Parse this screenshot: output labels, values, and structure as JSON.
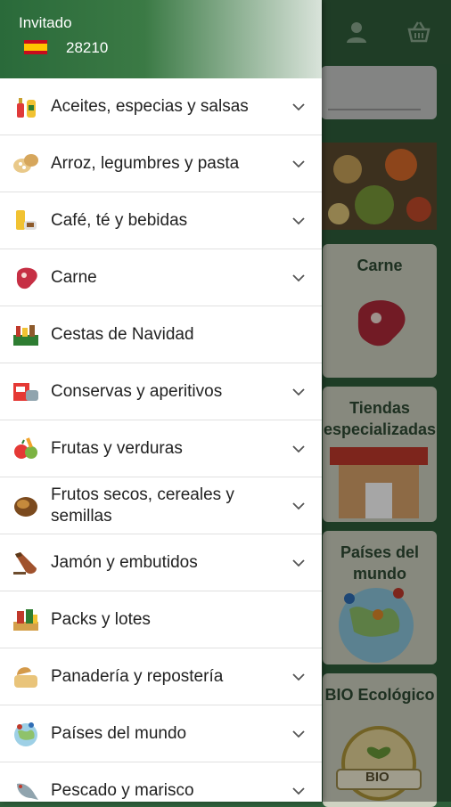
{
  "drawer": {
    "guest_label": "Invitado",
    "country_flag": "spain-flag-icon",
    "postcode": "28210"
  },
  "menu": [
    {
      "label": "Aceites, especias y salsas",
      "icon": "oil-bottle-icon",
      "expandable": true
    },
    {
      "label": "Arroz, legumbres y pasta",
      "icon": "grains-icon",
      "expandable": true
    },
    {
      "label": "Café, té y bebidas",
      "icon": "coffee-icon",
      "expandable": true
    },
    {
      "label": "Carne",
      "icon": "steak-icon",
      "expandable": true
    },
    {
      "label": "Cestas de Navidad",
      "icon": "christmas-basket-icon",
      "expandable": false
    },
    {
      "label": "Conservas y aperitivos",
      "icon": "canned-food-icon",
      "expandable": true
    },
    {
      "label": "Frutas y verduras",
      "icon": "fruit-icon",
      "expandable": true
    },
    {
      "label": "Frutos secos, cereales y semillas",
      "icon": "nut-icon",
      "expandable": true
    },
    {
      "label": "Jamón y embutidos",
      "icon": "ham-icon",
      "expandable": true
    },
    {
      "label": "Packs y lotes",
      "icon": "pack-icon",
      "expandable": false
    },
    {
      "label": "Panadería y repostería",
      "icon": "bread-icon",
      "expandable": true
    },
    {
      "label": "Países del mundo",
      "icon": "globe-icon",
      "expandable": true
    },
    {
      "label": "Pescado y marisco",
      "icon": "fish-icon",
      "expandable": true
    }
  ],
  "background": {
    "cards": [
      "Carne",
      "Tiendas especializadas",
      "Países del mundo",
      "BIO Ecológico"
    ],
    "bio_badge": "BIO"
  },
  "colors": {
    "brand_green": "#2f5f3b",
    "chevron": "#555555"
  }
}
